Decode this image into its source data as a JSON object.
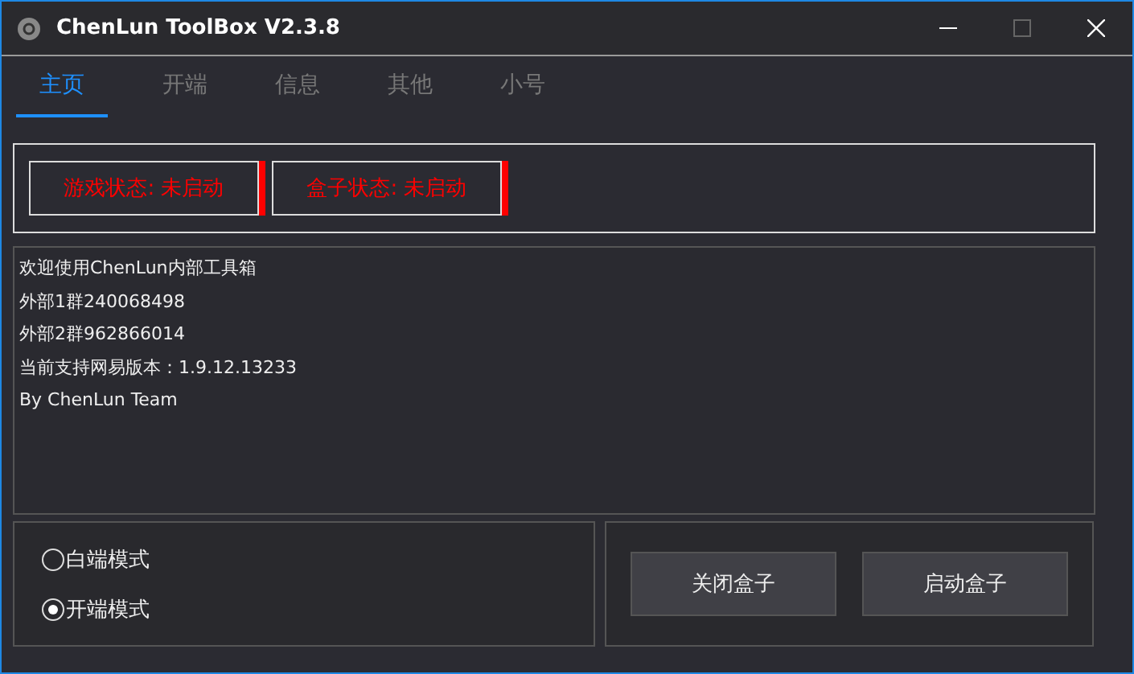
{
  "window": {
    "title": "ChenLun ToolBox V2.3.8",
    "maximize_disabled": true
  },
  "tabs": [
    {
      "label": "主页",
      "selected": true
    },
    {
      "label": "开端",
      "selected": false
    },
    {
      "label": "信息",
      "selected": false
    },
    {
      "label": "其他",
      "selected": false
    },
    {
      "label": "小号",
      "selected": false
    }
  ],
  "status": [
    {
      "label": "游戏状态: 未启动",
      "color": "#ff0000"
    },
    {
      "label": "盒子状态: 未启动",
      "color": "#ff0000"
    }
  ],
  "log": [
    "欢迎使用ChenLun内部工具箱",
    "外部1群240068498",
    "外部2群962866014",
    "当前支持网易版本：1.9.12.13233",
    "By ChenLun Team"
  ],
  "modes": [
    {
      "label": "白端模式",
      "selected": false
    },
    {
      "label": "开端模式",
      "selected": true
    }
  ],
  "buttons": [
    "关闭盒子",
    "启动盒子"
  ]
}
